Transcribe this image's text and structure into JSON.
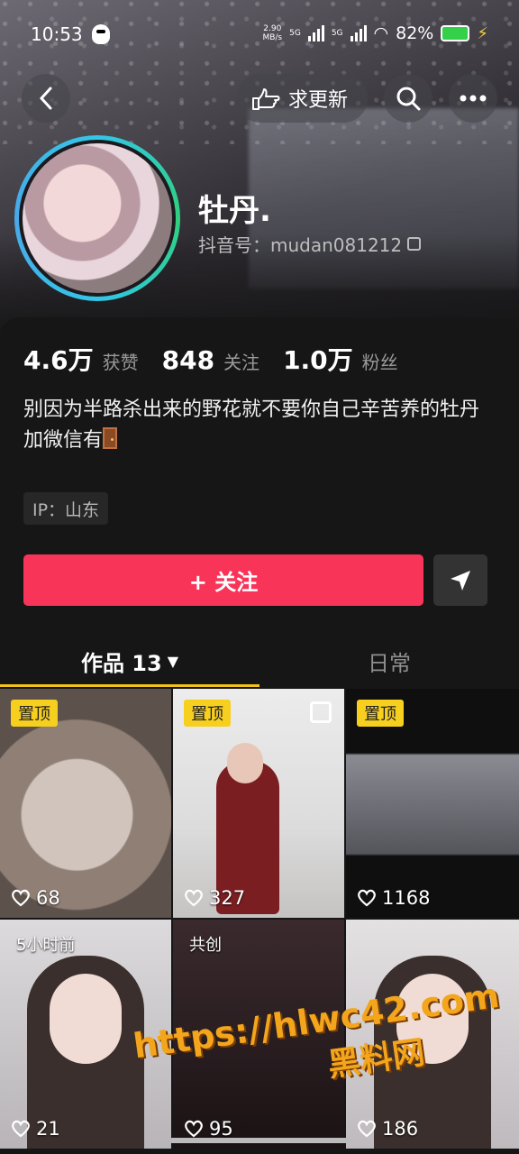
{
  "status_bar": {
    "time": "10:53",
    "speed_value": "2.90",
    "speed_unit": "MB/s",
    "net1": "5G",
    "net2": "5G",
    "battery": "82%"
  },
  "nav": {
    "request_update_label": "求更新"
  },
  "profile": {
    "name": "牡丹.",
    "douyin_id": "抖音号：mudan081212"
  },
  "stats": [
    {
      "num": "4.6万",
      "label": "获赞"
    },
    {
      "num": "848",
      "label": "关注"
    },
    {
      "num": "1.0万",
      "label": "粉丝"
    }
  ],
  "bio": {
    "line1": "别因为半路杀出来的野花就不要你自己辛苦养的牡丹",
    "line2": "加微信有"
  },
  "ip": "IP：山东",
  "follow_label": "+ 关注",
  "tabs": {
    "works": "作品 13",
    "daily": "日常"
  },
  "videos": [
    {
      "tag": "置顶",
      "likes": "68"
    },
    {
      "tag": "置顶",
      "likes": "327"
    },
    {
      "tag": "置顶",
      "likes": "1168"
    },
    {
      "tag": "5小时前",
      "likes": "21"
    },
    {
      "tag": "共创",
      "likes": "95"
    },
    {
      "tag": "",
      "likes": "186"
    }
  ],
  "watermark": {
    "url": "https://hlwc42.com",
    "cn": "黑料网"
  },
  "icons": [
    "back-icon",
    "hand-icon",
    "search-icon",
    "more-icon",
    "copy-icon",
    "send-icon",
    "heart-icon",
    "caret-down-icon",
    "multi-image-icon"
  ],
  "colors": {
    "follow": "#f83559",
    "pin": "#f7cf1f",
    "tab_indicator": "#f3c21b"
  }
}
